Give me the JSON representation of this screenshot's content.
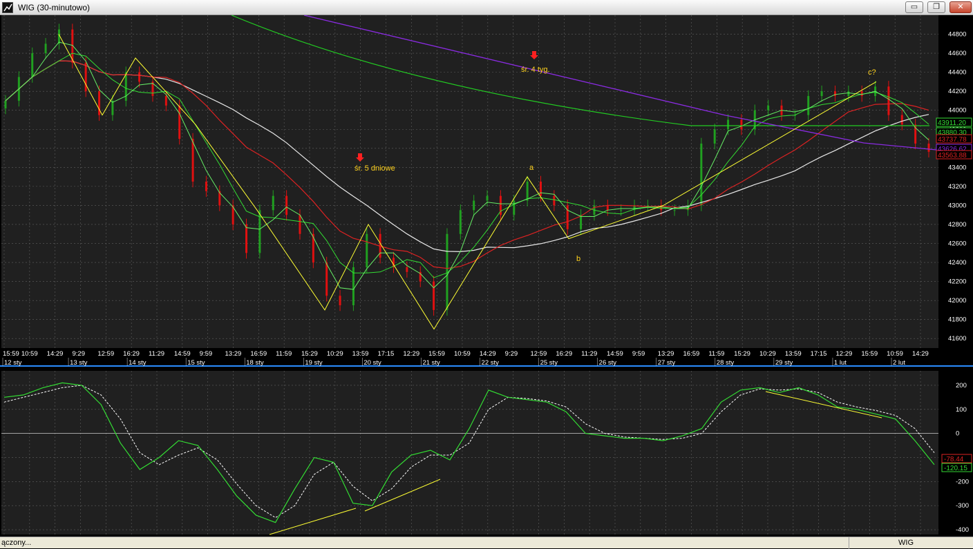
{
  "window": {
    "title": "WIG (30-minutowo)",
    "buttons": {
      "minimize": "▭",
      "maximize": "❐",
      "close": "✕"
    },
    "icon": "chart-icon"
  },
  "statusbar": {
    "left": "ączony...",
    "right": "WIG"
  },
  "colors": {
    "background": "#000000",
    "plot_bg": "#202020",
    "grid": "#606060",
    "up_candle": "#20a020",
    "down_candle": "#e01010",
    "ma_fast": "#33dd33",
    "ma_red": "#dd2222",
    "ma_white": "#e8e8e8",
    "ma_green_long": "#22cc22",
    "ma_purple": "#8a2be2",
    "wave_lines": "#ffff33",
    "annotation": "#ffd21e",
    "oscillator": "#33dd33",
    "oscillator_signal": "#ffffff"
  },
  "chart_data": [
    {
      "type": "candlestick",
      "title": "WIG (30-minutowo)",
      "ylim": [
        41500,
        45000
      ],
      "y_ticks": [
        41600,
        41800,
        42000,
        42200,
        42400,
        42600,
        42800,
        43000,
        43200,
        43400,
        43600,
        43800,
        44000,
        44200,
        44400,
        44600,
        44800
      ],
      "x_time_labels": [
        "15:59",
        "10:59",
        "14:29",
        "9:29",
        "12:59",
        "16:29",
        "11:29",
        "14:59",
        "9:59",
        "13:29",
        "16:59",
        "11:59",
        "15:29",
        "10:29",
        "13:59",
        "17:15",
        "12:29",
        "15:59",
        "10:59",
        "14:29",
        "9:29",
        "12:59",
        "16:29",
        "11:29",
        "14:59",
        "9:59",
        "13:29",
        "16:59",
        "11:59",
        "15:29",
        "10:29",
        "13:59",
        "17:15",
        "12:29",
        "15:59",
        "10:59",
        "14:29"
      ],
      "x_date_labels": [
        "12 sty",
        "13 sty",
        "14 sty",
        "15 sty",
        "18 sty",
        "19 sty",
        "20 sty",
        "21 sty",
        "22 sty",
        "25 sty",
        "26 sty",
        "27 sty",
        "28 sty",
        "29 sty",
        "1 lut",
        "2 lut"
      ],
      "price_labels": [
        {
          "text": "43911.20",
          "color": "#33dd33"
        },
        {
          "text": "43880.30",
          "color": "#33dd33"
        },
        {
          "text": "43737.78",
          "color": "#dd2222"
        },
        {
          "text": "43626.62",
          "color": "#8a2be2"
        },
        {
          "text": "43563.88",
          "color": "#dd2222"
        }
      ],
      "annotations": [
        {
          "text": "śr. 4 tyg."
        },
        {
          "text": "śr. 5 dniowe"
        },
        {
          "text": "a"
        },
        {
          "text": "b"
        },
        {
          "text": "c?"
        }
      ],
      "wave_path": [
        44800,
        43950,
        44550,
        43850,
        42950,
        41900,
        42800,
        41700,
        43300,
        42650,
        43000,
        44300
      ],
      "series": [
        {
          "name": "close",
          "values": [
            44100,
            44350,
            44600,
            44700,
            44850,
            44500,
            44200,
            43950,
            44100,
            44400,
            44300,
            44150,
            44050,
            43700,
            43250,
            43150,
            43000,
            42800,
            42500,
            42950,
            43100,
            42900,
            42700,
            42400,
            42050,
            41950,
            42350,
            42700,
            42450,
            42350,
            42300,
            42200,
            41900,
            42700,
            42950,
            43050,
            43100,
            42900,
            43050,
            43250,
            43100,
            43000,
            42750,
            42900,
            43000,
            42950,
            42950,
            43000,
            43000,
            42950,
            42950,
            43000,
            43650,
            43800,
            43900,
            43800,
            44000,
            44050,
            43950,
            43950,
            44150,
            44200,
            44150,
            44200,
            44150,
            44250,
            43950,
            43850,
            43650,
            43563.88
          ]
        }
      ]
    },
    {
      "type": "line",
      "ylim": [
        -420,
        260
      ],
      "y_ticks": [
        200,
        100,
        0,
        -100,
        -200,
        -300,
        -400
      ],
      "value_labels": [
        {
          "text": "-78.44",
          "color": "#dd2222"
        },
        {
          "text": "-120.15",
          "color": "#33dd33"
        }
      ],
      "series": [
        {
          "name": "oscillator",
          "values": [
            150,
            160,
            190,
            210,
            200,
            120,
            -40,
            -150,
            -100,
            -30,
            -50,
            -150,
            -260,
            -340,
            -370,
            -230,
            -100,
            -120,
            -290,
            -300,
            -160,
            -90,
            -70,
            -110,
            20,
            180,
            150,
            140,
            130,
            90,
            0,
            -10,
            -20,
            -20,
            -30,
            -10,
            20,
            130,
            180,
            190,
            170,
            190,
            160,
            110,
            100,
            80,
            60,
            -30,
            -130
          ]
        },
        {
          "name": "signal",
          "values": [
            130,
            150,
            170,
            190,
            200,
            160,
            60,
            -80,
            -130,
            -90,
            -60,
            -110,
            -210,
            -300,
            -350,
            -300,
            -170,
            -120,
            -220,
            -280,
            -230,
            -140,
            -90,
            -90,
            -40,
            100,
            150,
            145,
            135,
            110,
            40,
            0,
            -15,
            -20,
            -25,
            -20,
            0,
            90,
            160,
            185,
            180,
            185,
            170,
            130,
            110,
            95,
            75,
            20,
            -80
          ]
        }
      ]
    }
  ]
}
